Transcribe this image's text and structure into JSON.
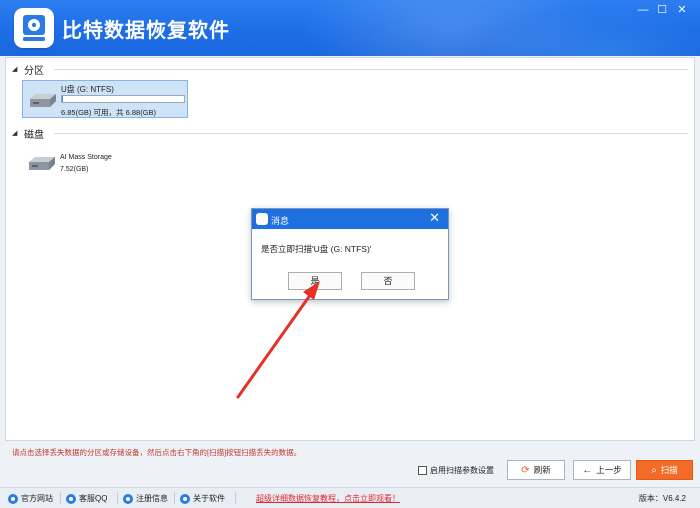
{
  "app": {
    "title": "比特数据恢复软件",
    "window_controls": [
      "—",
      "☐",
      "✕"
    ],
    "accent": "#1e6fe0"
  },
  "sections": {
    "partition": {
      "label": "分区"
    },
    "disk": {
      "label": "磁盘"
    }
  },
  "partition_card": {
    "name": "U盘 (G: NTFS)",
    "capacity": "6.85(GB) 可用，共 6.88(GB)",
    "used_fraction": 0.004
  },
  "disk_item": {
    "name": "AI Mass Storage",
    "capacity": "7.52(GB)"
  },
  "dialog": {
    "title": "消息",
    "close": "✕",
    "message": "是否立即扫描'U盘 (G: NTFS)'",
    "yes": "是",
    "no": "否"
  },
  "hint": "请点击选择丢失数据的分区或存储设备，然后点击右下角的[扫描]按钮扫描丢失的数据。",
  "options": {
    "scan_settings": "启用扫描参数设置"
  },
  "buttons": {
    "refresh": "刷新",
    "prev": "上一步",
    "scan": "扫描"
  },
  "statusbar": {
    "items": [
      "官方网站",
      "客服QQ",
      "注册信息",
      "关于软件"
    ],
    "promo": "超级详细数据恢复教程，点击立即观看！",
    "version": "版本：V6.4.2"
  },
  "colors": {
    "scan_button": "#f46a28",
    "hint": "#c0392b",
    "promo": "#e0262f",
    "arrow": "#e53228"
  }
}
